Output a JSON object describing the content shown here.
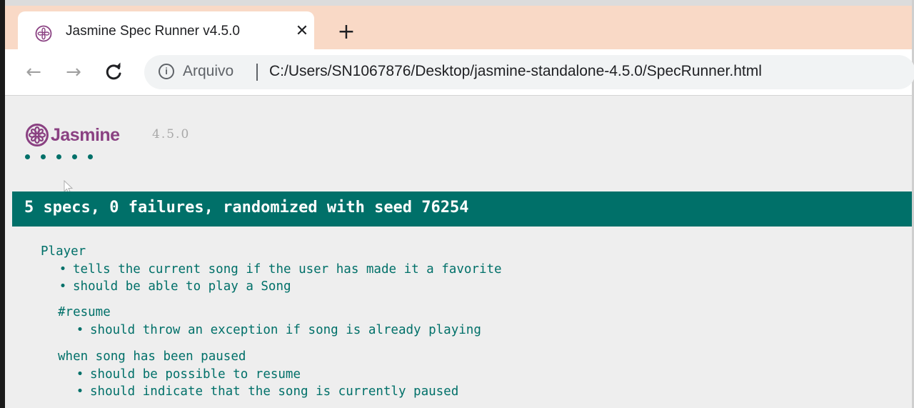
{
  "browser": {
    "tab": {
      "title": "Jasmine Spec Runner v4.5.0",
      "favicon": "jasmine-flower-icon",
      "close_glyph": "✕"
    },
    "new_tab_glyph": "+",
    "nav": {
      "back_glyph": "←",
      "forward_glyph": "→",
      "reload_glyph": "C"
    },
    "omnibox": {
      "info_glyph": "i",
      "origin_label": "Arquivo",
      "url": "C:/Users/SN1067876/Desktop/jasmine-standalone-4.5.0/SpecRunner.html"
    },
    "colors": {
      "tabstrip": "#f9d9c6",
      "page_bg": "#eeeeee"
    }
  },
  "jasmine": {
    "logo_text": "Jasmine",
    "version": "4.5.0",
    "spec_dot_count": 5,
    "summary": "5 specs, 0 failures, randomized with seed 76254",
    "colors": {
      "passed": "#007069",
      "brand": "#8a4182"
    },
    "results": {
      "suite": "Player",
      "specs": [
        "tells the current song if the user has made it a favorite",
        "should be able to play a Song"
      ],
      "subsuites": [
        {
          "name": "#resume",
          "specs": [
            "should throw an exception if song is already playing"
          ]
        },
        {
          "name": "when song has been paused",
          "specs": [
            "should be possible to resume",
            "should indicate that the song is currently paused"
          ]
        }
      ]
    }
  }
}
